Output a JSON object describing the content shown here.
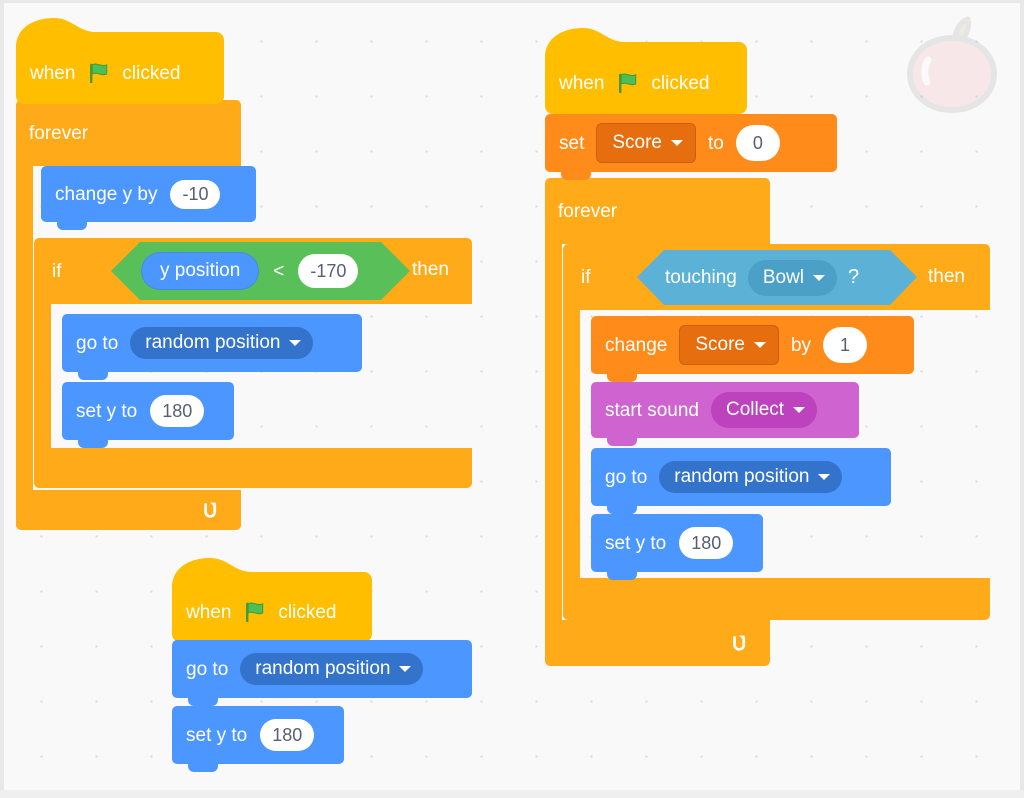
{
  "workspace": {
    "background_color": "#f9f9f9",
    "grid_dot_color": "#d9d9d9"
  },
  "watermark": {
    "name": "apple-sprite-watermark",
    "body_color": "#F5A3AE",
    "outline_color": "#9B9B9B",
    "stem_color": "#BFAE8E"
  },
  "palette": {
    "event": "#FFBF00",
    "control": "#FFAB19",
    "motion": "#4C97FF",
    "motion_dark": "#3373CC",
    "variables": "#FF8C1A",
    "variables_dark": "#E76E0E",
    "sound": "#CF63CF",
    "sound_dark": "#BD42BD",
    "sensing": "#5CB1D6",
    "sensing_dark": "#4AA0C6",
    "operators": "#59C059",
    "input_text": "#575E75"
  },
  "scripts": {
    "falling_apple": {
      "hat": {
        "when": "when",
        "clicked": "clicked",
        "icon": "green-flag-icon"
      },
      "forever": "forever",
      "change_y": {
        "label": "change y by",
        "value": "-10"
      },
      "if_block": {
        "if": "if",
        "then": "then"
      },
      "condition": {
        "operand_left": "y position",
        "operator": "<",
        "operand_right": "-170"
      },
      "go_to": {
        "label": "go to",
        "option": "random position"
      },
      "set_y": {
        "label": "set y to",
        "value": "180"
      }
    },
    "scoring": {
      "hat": {
        "when": "when",
        "clicked": "clicked",
        "icon": "green-flag-icon"
      },
      "set_var": {
        "label": "set",
        "variable": "Score",
        "to": "to",
        "value": "0"
      },
      "forever": "forever",
      "if_block": {
        "if": "if",
        "then": "then"
      },
      "condition": {
        "label": "touching",
        "option": "Bowl",
        "question": "?"
      },
      "change_var": {
        "label": "change",
        "variable": "Score",
        "by": "by",
        "value": "1"
      },
      "start_sound": {
        "label": "start sound",
        "option": "Collect"
      },
      "go_to": {
        "label": "go to",
        "option": "random position"
      },
      "set_y": {
        "label": "set y to",
        "value": "180"
      }
    },
    "reset_position": {
      "hat": {
        "when": "when",
        "clicked": "clicked",
        "icon": "green-flag-icon"
      },
      "go_to": {
        "label": "go to",
        "option": "random position"
      },
      "set_y": {
        "label": "set y to",
        "value": "180"
      }
    }
  }
}
